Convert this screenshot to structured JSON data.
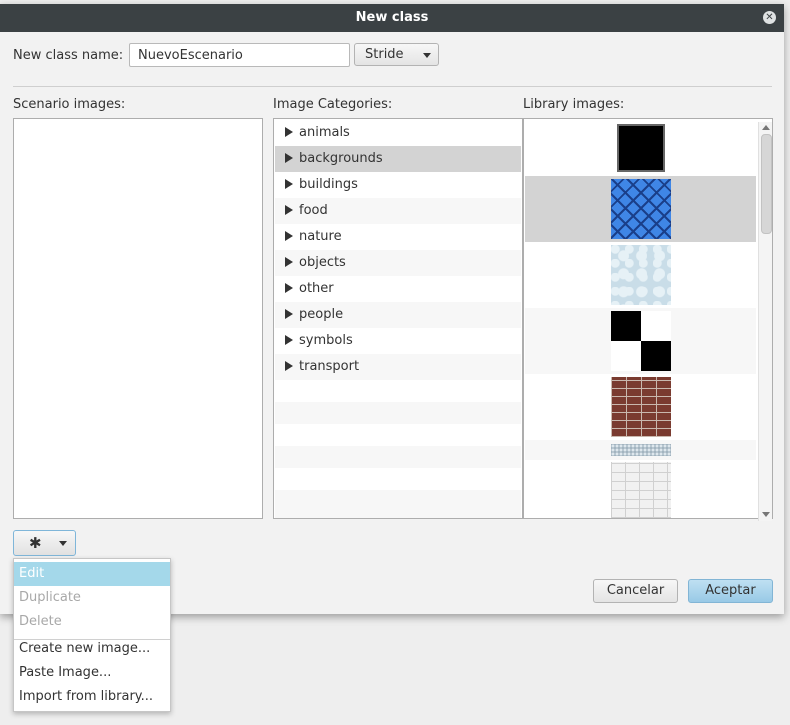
{
  "dialog": {
    "title": "New class",
    "class_name_label": "New class name:",
    "class_name_value": "NuevoEscenario",
    "superclass_value": "Stride",
    "scenario_images_label": "Scenario images:",
    "image_categories_label": "Image Categories:",
    "library_images_label": "Library images:",
    "categories": [
      "animals",
      "backgrounds",
      "buildings",
      "food",
      "nature",
      "objects",
      "other",
      "people",
      "symbols",
      "transport"
    ],
    "selected_category": "backgrounds",
    "library_images": [
      "black-frame",
      "blue-tiles",
      "ice-texture",
      "checkerboard",
      "brick-wall",
      "gravel-strip",
      "white-brick"
    ],
    "selected_library_image": "blue-tiles",
    "cancel_label": "Cancelar",
    "accept_label": "Aceptar"
  },
  "context_menu": {
    "items": [
      {
        "label": "Edit",
        "state": "selected"
      },
      {
        "label": "Duplicate",
        "state": "disabled"
      },
      {
        "label": "Delete",
        "state": "disabled"
      },
      {
        "label": "Create new image...",
        "state": "enabled"
      },
      {
        "label": "Paste Image...",
        "state": "enabled"
      },
      {
        "label": "Import from library...",
        "state": "enabled"
      }
    ]
  },
  "colors": {
    "titlebar": "#3b4144",
    "selection": "#d3d3d3",
    "menu_highlight": "#a4d8ea",
    "accept_button": "#a9d2ea"
  }
}
